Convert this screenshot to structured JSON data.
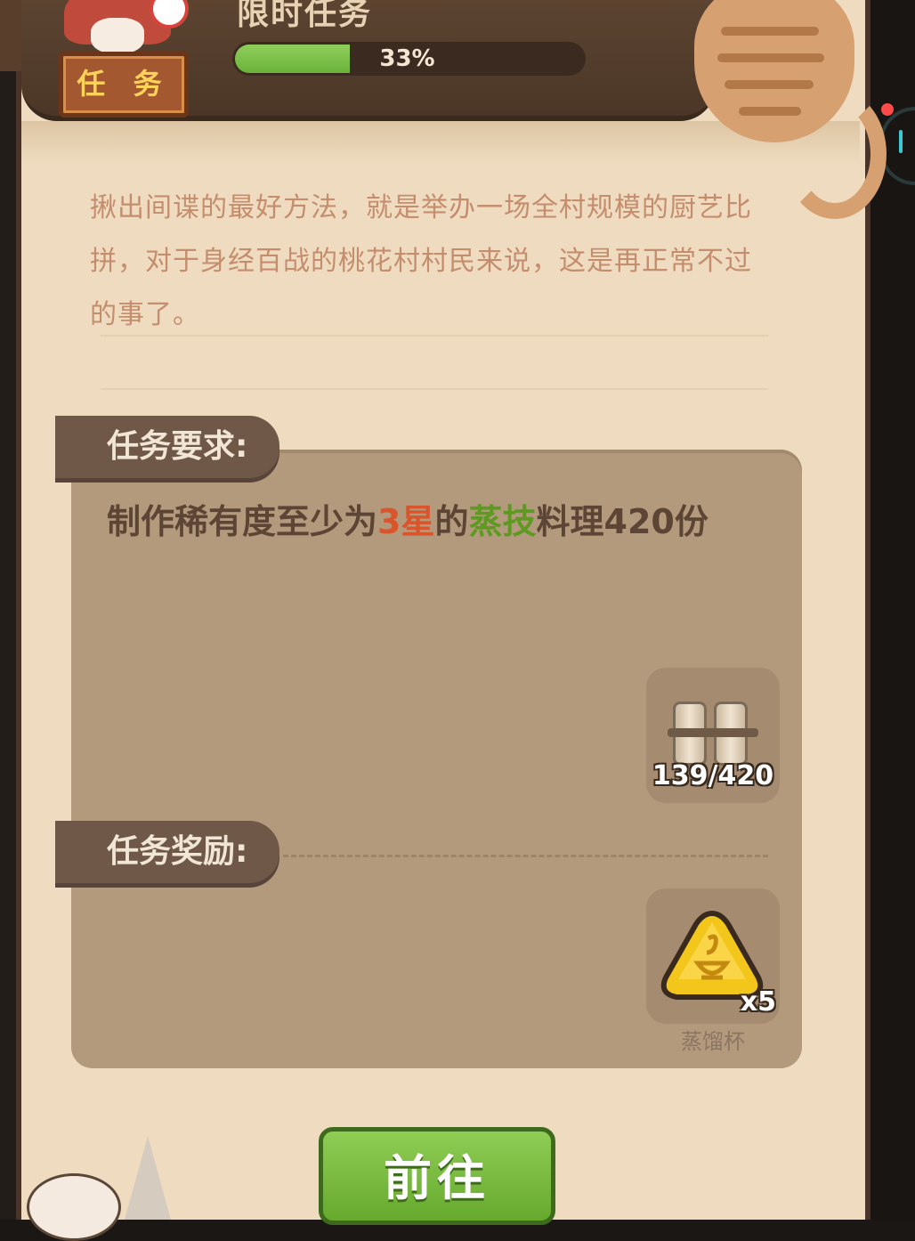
{
  "header": {
    "title": "限时任务",
    "task_label": "任 务",
    "progress_percent": 33,
    "progress_text": "33%"
  },
  "description": "揪出间谍的最好方法，就是举办一场全村规模的厨艺比拼，对于身经百战的桃花村村民来说，这是再正常不过的事了。",
  "requirements": {
    "label": "任务要求:",
    "text_prefix": "制作稀有度至少为",
    "text_star": "3星",
    "text_mid": "的",
    "text_category": "蒸技",
    "text_suffix": "料理420份",
    "item_progress": "139/420",
    "item_icon": "scroll-icon"
  },
  "rewards": {
    "label": "任务奖励:",
    "item_icon": "steam-cup-icon",
    "item_count": "x5",
    "item_name": "蒸馏杯"
  },
  "buttons": {
    "goto": "前往"
  },
  "colors": {
    "star_red": "#d9552c",
    "category_green": "#5e9a22",
    "progress_green": "#6ab23a"
  }
}
